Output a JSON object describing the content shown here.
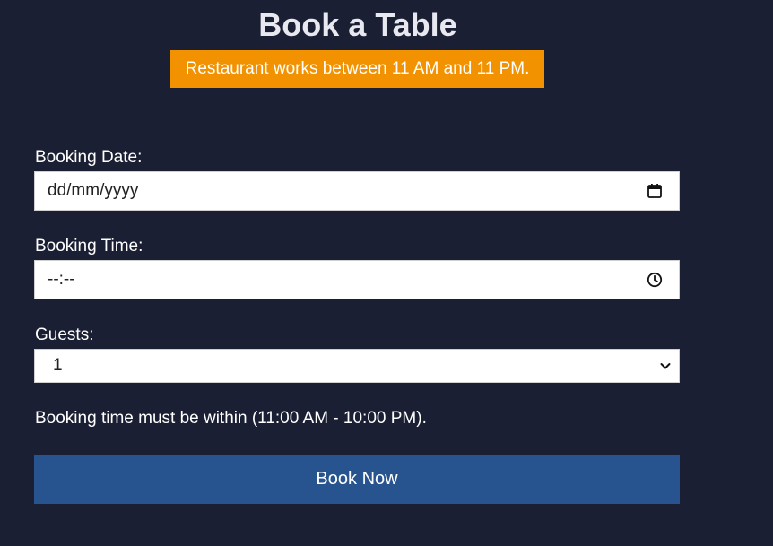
{
  "header": {
    "title": "Book a Table",
    "notice": "Restaurant works between 11 AM and 11 PM."
  },
  "form": {
    "date": {
      "label": "Booking Date:",
      "placeholder": "dd/mm/yyyy",
      "icon": "calendar-icon"
    },
    "time": {
      "label": "Booking Time:",
      "placeholder": "--:--",
      "icon": "clock-icon"
    },
    "guests": {
      "label": "Guests:",
      "value": "1",
      "icon": "chevron-down-icon"
    },
    "hint": "Booking time must be within (11:00 AM - 10:00 PM).",
    "submit_label": "Book Now"
  },
  "colors": {
    "background": "#1b1f33",
    "notice_bg": "#f39200",
    "button_bg": "#27548f"
  }
}
